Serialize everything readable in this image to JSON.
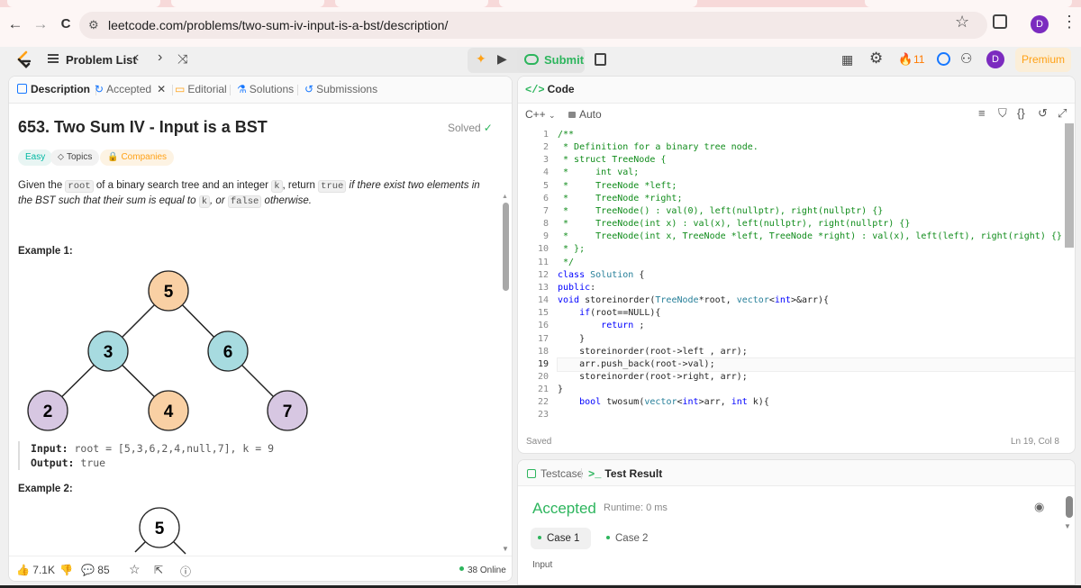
{
  "browser": {
    "back": "←",
    "forward": "→",
    "reload": "C",
    "url": "leetcode.com/problems/two-sum-iv-input-is-a-bst/description/",
    "profile_initial": "D"
  },
  "header": {
    "problem_list": "Problem List",
    "submit": "Submit",
    "streak_count": "11",
    "avatar_initial": "D",
    "premium": "Premium"
  },
  "left_tabs": {
    "description": "Description",
    "accepted": "Accepted",
    "editorial": "Editorial",
    "solutions": "Solutions",
    "submissions": "Submissions"
  },
  "problem": {
    "title": "653. Two Sum IV - Input is a BST",
    "status": "Solved",
    "difficulty": "Easy",
    "topics": "Topics",
    "companies": "Companies",
    "desc": {
      "p1": "Given the ",
      "root": "root",
      "p2": " of a binary search tree and an integer ",
      "k1": "k",
      "p3": ", return ",
      "true_code": "true",
      "p4": " if there exist two elements in the BST such that their sum is equal to ",
      "k2": "k",
      "p5": ", or ",
      "false_code": "false",
      "p6": " otherwise."
    },
    "example1_heading": "Example 1:",
    "example2_heading": "Example 2:",
    "example1_input_label": "Input:",
    "example1_input": " root = [5,3,6,2,4,null,7], k = 9",
    "example1_output_label": "Output:",
    "example1_output": " true",
    "tree1_nodes": [
      "5",
      "3",
      "6",
      "2",
      "4",
      "7"
    ],
    "tree2_root": "5",
    "node_colors": {
      "orange": "#f9d0a4",
      "teal": "#a7dbe0",
      "purple": "#d7c7e2"
    }
  },
  "footer": {
    "likes": "7.1K",
    "comments": "85",
    "online": "38 Online"
  },
  "code_panel": {
    "title": "Code",
    "language": "C++",
    "mode": "Auto",
    "saved": "Saved",
    "cursor": "Ln 19, Col 8",
    "line_numbers": [
      "1",
      "2",
      "3",
      "4",
      "5",
      "6",
      "7",
      "8",
      "9",
      "10",
      "11",
      "12",
      "13",
      "14",
      "15",
      "16",
      "17",
      "18",
      "19",
      "20",
      "21",
      "22",
      "23"
    ]
  },
  "result": {
    "testcase_tab": "Testcase",
    "result_tab": "Test Result",
    "status": "Accepted",
    "runtime": "Runtime: 0 ms",
    "case1": "Case 1",
    "case2": "Case 2",
    "input_label": "Input"
  }
}
